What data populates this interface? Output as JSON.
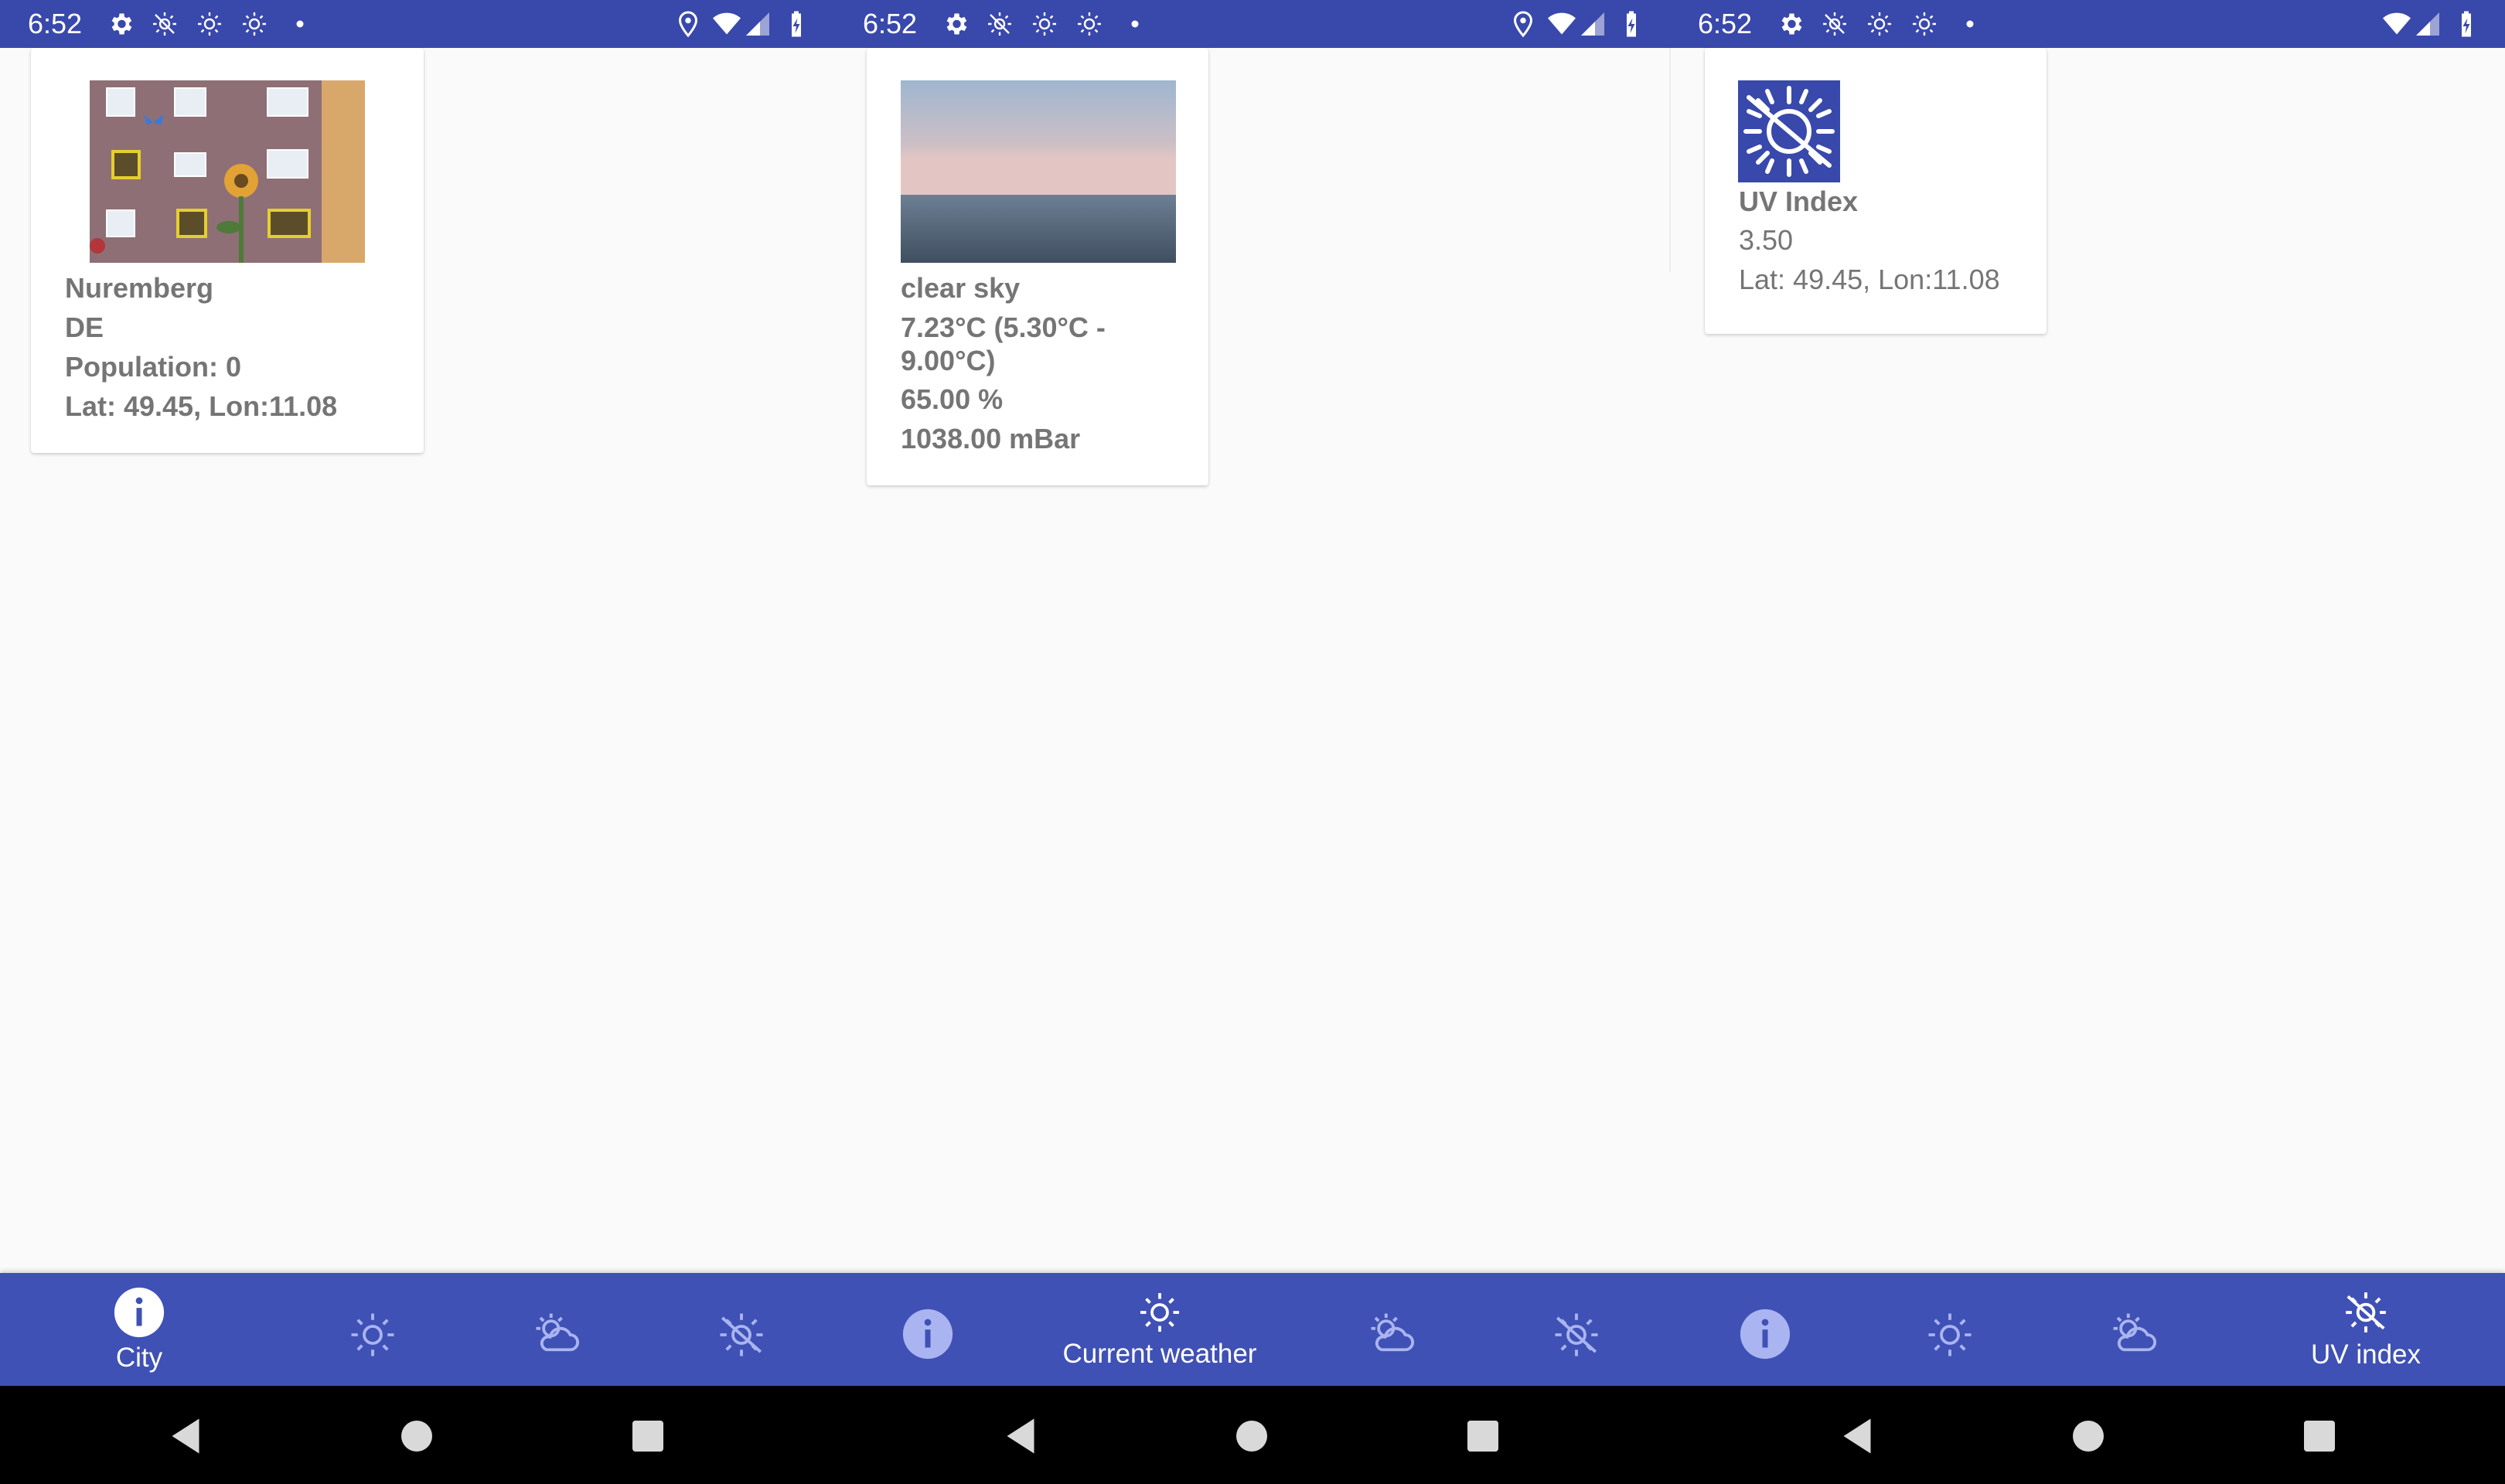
{
  "status_bar": {
    "time": "6:52"
  },
  "city_card": {
    "name": "Nuremberg",
    "country": "DE",
    "population": "Population: 0",
    "coords": "Lat: 49.45, Lon:11.08"
  },
  "weather_card": {
    "description": "clear sky",
    "temperature_line1": "7.23°C (5.30°C -",
    "temperature_line2": "9.00°C)",
    "humidity": "65.00 %",
    "pressure": "1038.00 mBar"
  },
  "uv_card": {
    "title": "UV Index",
    "value": "3.50",
    "coords": "Lat: 49.45, Lon:11.08"
  },
  "bottom_nav": {
    "city_label": "City",
    "current_weather_label": "Current weather",
    "uv_index_label": "UV index"
  },
  "colors": {
    "primary": "#3f51b5",
    "primary_dark": "#3948ab",
    "inactive_icon": "#aab4f0",
    "card_text": "#757575"
  }
}
